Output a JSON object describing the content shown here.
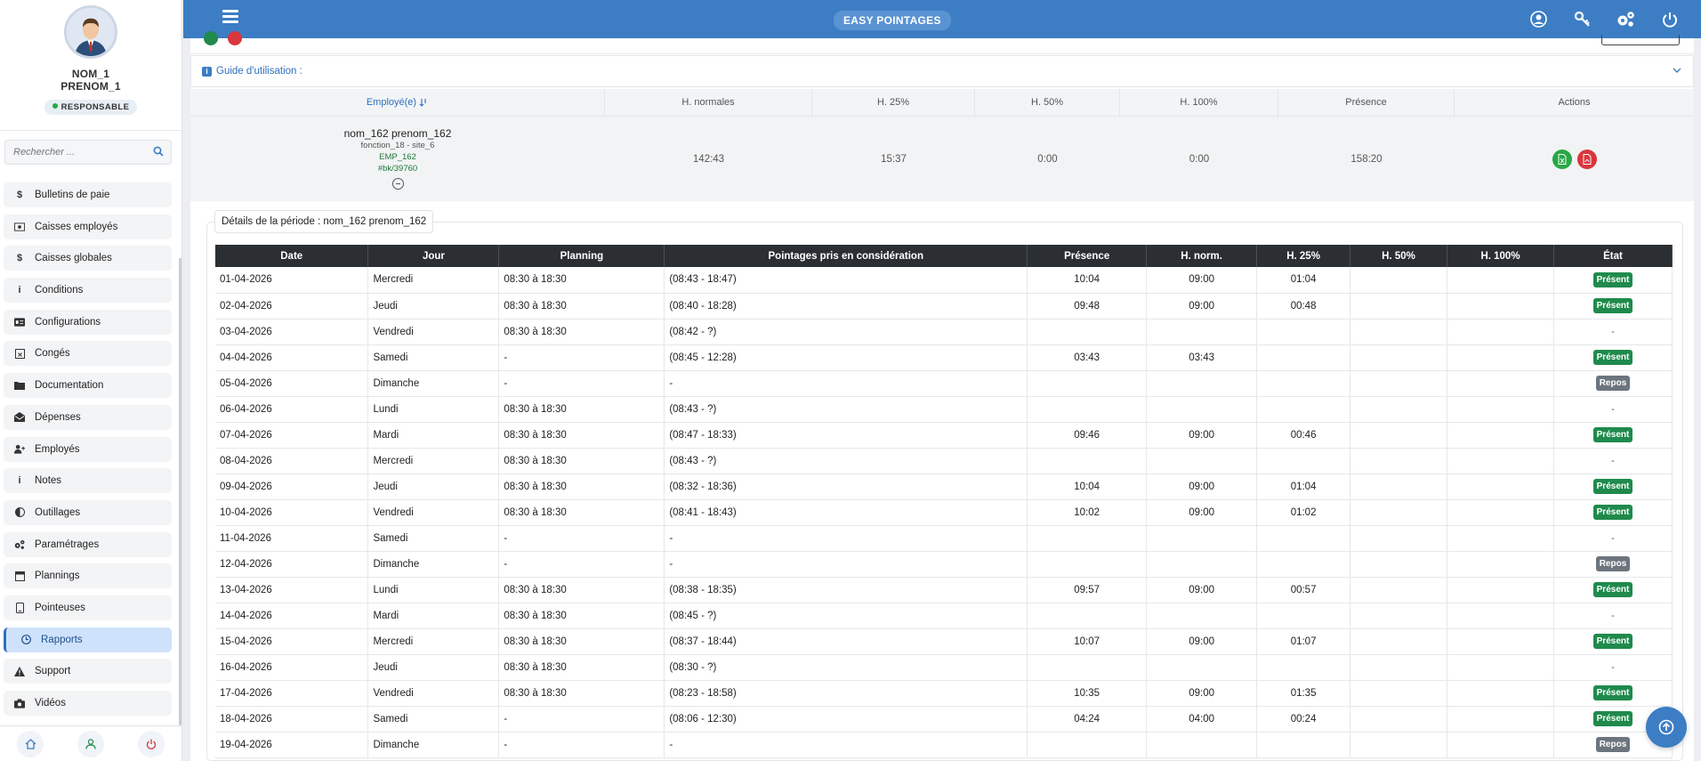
{
  "app": {
    "title": "EASY POINTAGES"
  },
  "user": {
    "name_line1": "NOM_1",
    "name_line2": "PRENOM_1",
    "role": "RESPONSABLE"
  },
  "search": {
    "placeholder": "Rechercher ..."
  },
  "menu": [
    {
      "label": "Bulletins de paie",
      "icon": "dollar-icon"
    },
    {
      "label": "Caisses employés",
      "icon": "money-icon"
    },
    {
      "label": "Caisses globales",
      "icon": "dollar-icon"
    },
    {
      "label": "Conditions",
      "icon": "info-icon"
    },
    {
      "label": "Configurations",
      "icon": "id-card-icon"
    },
    {
      "label": "Congés",
      "icon": "calendar-x-icon"
    },
    {
      "label": "Documentation",
      "icon": "folder-icon"
    },
    {
      "label": "Dépenses",
      "icon": "envelope-open-icon"
    },
    {
      "label": "Employés",
      "icon": "user-plus-icon"
    },
    {
      "label": "Notes",
      "icon": "info-icon"
    },
    {
      "label": "Outillages",
      "icon": "half-circle-icon"
    },
    {
      "label": "Paramétrages",
      "icon": "gears-icon"
    },
    {
      "label": "Plannings",
      "icon": "calendar-icon"
    },
    {
      "label": "Pointeuses",
      "icon": "tablet-icon"
    },
    {
      "label": "Rapports",
      "icon": "clock-icon",
      "active": true
    },
    {
      "label": "Support",
      "icon": "warning-icon"
    },
    {
      "label": "Vidéos",
      "icon": "camera-icon"
    }
  ],
  "guide": {
    "label": "Guide d'utilisation :"
  },
  "employee_table": {
    "headers": [
      "Employé(e)",
      "H. normales",
      "H. 25%",
      "H. 50%",
      "H. 100%",
      "Présence",
      "Actions"
    ],
    "row": {
      "name": "nom_162 prenom_162",
      "function": "fonction_18 - site_6",
      "code": "EMP_162",
      "badge": "#bk/39760",
      "h_normales": "142:43",
      "h25": "15:37",
      "h50": "0:00",
      "h100": "0:00",
      "presence": "158:20"
    }
  },
  "details": {
    "label": "Détails de la période : nom_162 prenom_162",
    "headers": [
      "Date",
      "Jour",
      "Planning",
      "Pointages pris en considération",
      "Présence",
      "H. norm.",
      "H. 25%",
      "H. 50%",
      "H. 100%",
      "État"
    ],
    "rows": [
      {
        "date": "01-04-2026",
        "day": "Mercredi",
        "planning": "08:30 à 18:30",
        "pointages": "(08:43 - 18:47)",
        "presence": "10:04",
        "hnorm": "09:00",
        "h25": "01:04",
        "h50": "",
        "h100": "",
        "state": "Présent"
      },
      {
        "date": "02-04-2026",
        "day": "Jeudi",
        "planning": "08:30 à 18:30",
        "pointages": "(08:40 - 18:28)",
        "presence": "09:48",
        "hnorm": "09:00",
        "h25": "00:48",
        "h50": "",
        "h100": "",
        "state": "Présent"
      },
      {
        "date": "03-04-2026",
        "day": "Vendredi",
        "planning": "08:30 à 18:30",
        "pointages": "(08:42 - ?)",
        "presence": "",
        "hnorm": "",
        "h25": "",
        "h50": "",
        "h100": "",
        "state": "-"
      },
      {
        "date": "04-04-2026",
        "day": "Samedi",
        "planning": "-",
        "pointages": "(08:45 - 12:28)",
        "presence": "03:43",
        "hnorm": "03:43",
        "h25": "",
        "h50": "",
        "h100": "",
        "state": "Présent"
      },
      {
        "date": "05-04-2026",
        "day": "Dimanche",
        "planning": "-",
        "pointages": "-",
        "presence": "",
        "hnorm": "",
        "h25": "",
        "h50": "",
        "h100": "",
        "state": "Repos"
      },
      {
        "date": "06-04-2026",
        "day": "Lundi",
        "planning": "08:30 à 18:30",
        "pointages": "(08:43 - ?)",
        "presence": "",
        "hnorm": "",
        "h25": "",
        "h50": "",
        "h100": "",
        "state": "-"
      },
      {
        "date": "07-04-2026",
        "day": "Mardi",
        "planning": "08:30 à 18:30",
        "pointages": "(08:47 - 18:33)",
        "presence": "09:46",
        "hnorm": "09:00",
        "h25": "00:46",
        "h50": "",
        "h100": "",
        "state": "Présent"
      },
      {
        "date": "08-04-2026",
        "day": "Mercredi",
        "planning": "08:30 à 18:30",
        "pointages": "(08:43 - ?)",
        "presence": "",
        "hnorm": "",
        "h25": "",
        "h50": "",
        "h100": "",
        "state": "-"
      },
      {
        "date": "09-04-2026",
        "day": "Jeudi",
        "planning": "08:30 à 18:30",
        "pointages": "(08:32 - 18:36)",
        "presence": "10:04",
        "hnorm": "09:00",
        "h25": "01:04",
        "h50": "",
        "h100": "",
        "state": "Présent"
      },
      {
        "date": "10-04-2026",
        "day": "Vendredi",
        "planning": "08:30 à 18:30",
        "pointages": "(08:41 - 18:43)",
        "presence": "10:02",
        "hnorm": "09:00",
        "h25": "01:02",
        "h50": "",
        "h100": "",
        "state": "Présent"
      },
      {
        "date": "11-04-2026",
        "day": "Samedi",
        "planning": "-",
        "pointages": "-",
        "presence": "",
        "hnorm": "",
        "h25": "",
        "h50": "",
        "h100": "",
        "state": "-"
      },
      {
        "date": "12-04-2026",
        "day": "Dimanche",
        "planning": "-",
        "pointages": "-",
        "presence": "",
        "hnorm": "",
        "h25": "",
        "h50": "",
        "h100": "",
        "state": "Repos"
      },
      {
        "date": "13-04-2026",
        "day": "Lundi",
        "planning": "08:30 à 18:30",
        "pointages": "(08:38 - 18:35)",
        "presence": "09:57",
        "hnorm": "09:00",
        "h25": "00:57",
        "h50": "",
        "h100": "",
        "state": "Présent"
      },
      {
        "date": "14-04-2026",
        "day": "Mardi",
        "planning": "08:30 à 18:30",
        "pointages": "(08:45 - ?)",
        "presence": "",
        "hnorm": "",
        "h25": "",
        "h50": "",
        "h100": "",
        "state": "-"
      },
      {
        "date": "15-04-2026",
        "day": "Mercredi",
        "planning": "08:30 à 18:30",
        "pointages": "(08:37 - 18:44)",
        "presence": "10:07",
        "hnorm": "09:00",
        "h25": "01:07",
        "h50": "",
        "h100": "",
        "state": "Présent"
      },
      {
        "date": "16-04-2026",
        "day": "Jeudi",
        "planning": "08:30 à 18:30",
        "pointages": "(08:30 - ?)",
        "presence": "",
        "hnorm": "",
        "h25": "",
        "h50": "",
        "h100": "",
        "state": "-"
      },
      {
        "date": "17-04-2026",
        "day": "Vendredi",
        "planning": "08:30 à 18:30",
        "pointages": "(08:23 - 18:58)",
        "presence": "10:35",
        "hnorm": "09:00",
        "h25": "01:35",
        "h50": "",
        "h100": "",
        "state": "Présent"
      },
      {
        "date": "18-04-2026",
        "day": "Samedi",
        "planning": "-",
        "pointages": "(08:06 - 12:30)",
        "presence": "04:24",
        "hnorm": "04:00",
        "h25": "00:24",
        "h50": "",
        "h100": "",
        "state": "Présent"
      },
      {
        "date": "19-04-2026",
        "day": "Dimanche",
        "planning": "-",
        "pointages": "-",
        "presence": "",
        "hnorm": "",
        "h25": "",
        "h50": "",
        "h100": "",
        "state": "Repos"
      }
    ]
  },
  "colors": {
    "primary": "#3c7dc4",
    "present": "#1f8a4c",
    "repos": "#6c757d",
    "table_header": "#2b2f33"
  }
}
